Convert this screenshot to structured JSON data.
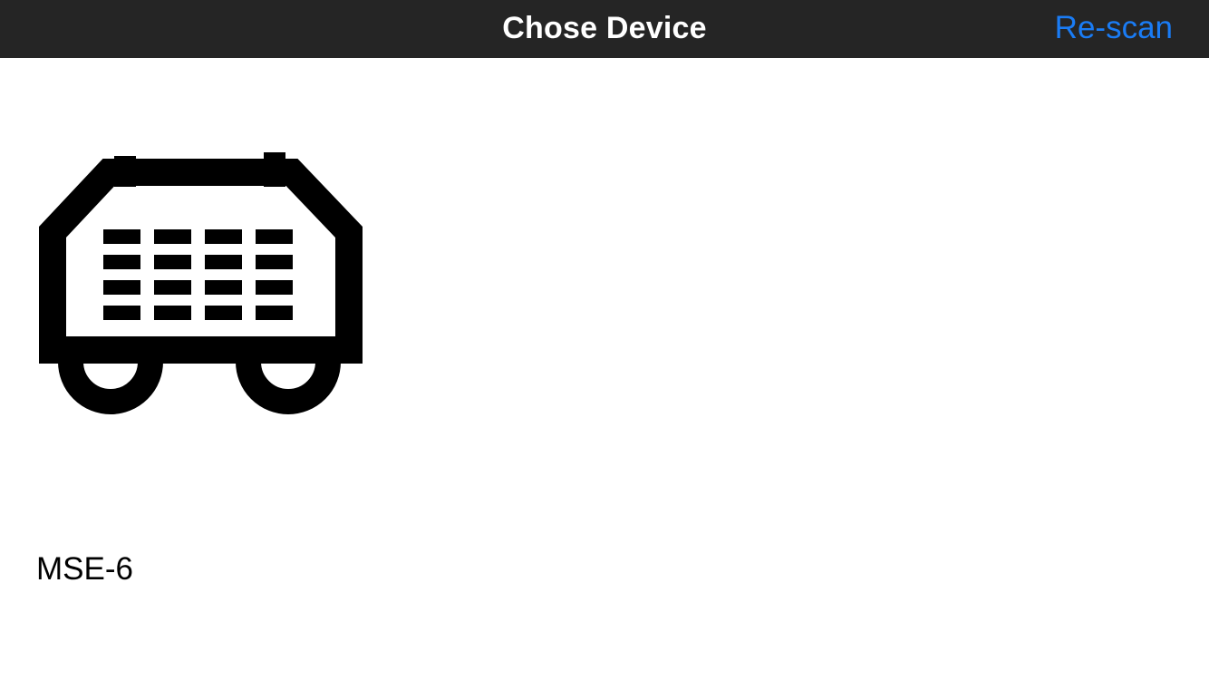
{
  "nav": {
    "title": "Chose Device",
    "rescan_label": "Re-scan",
    "background_color": "#252525",
    "accent_color": "#1a7cf5"
  },
  "devices": [
    {
      "name": "MSE-6",
      "icon": "robot-vehicle-icon"
    }
  ]
}
